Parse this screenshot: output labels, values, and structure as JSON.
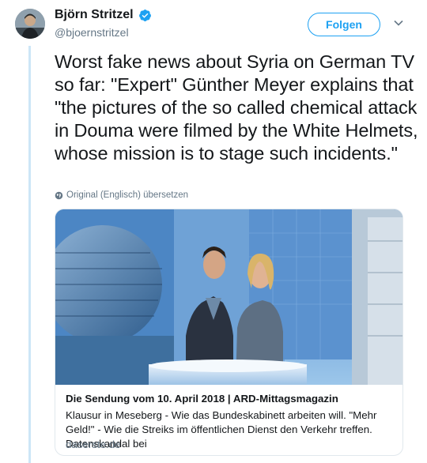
{
  "author": {
    "name": "Björn Stritzel",
    "handle": "@bjoernstritzel",
    "verified": true
  },
  "follow_button": {
    "label": "Folgen"
  },
  "tweet": {
    "text": "Worst fake news about Syria on German TV so far: \"Expert\" Günther Meyer explains that \"the pictures of the so called chemical attack in Douma were filmed by the White Helmets, whose mission is to stage such incidents.\""
  },
  "translate": {
    "label": "Original (Englisch) übersetzen"
  },
  "card": {
    "title": "Die Sendung vom 10. April 2018 | ARD-Mittagsmagazin",
    "description": "Klausur in Meseberg - Wie das Bundeskabinett arbeiten will. \"Mehr Geld!\" - Wie die Streiks im öffentlichen Dienst den Verkehr treffen. Datenskandal bei",
    "domain": "daserste.de"
  },
  "colors": {
    "accent": "#1da1f2",
    "secondary_text": "#657786",
    "thread_line": "#cde6f7"
  },
  "icons": [
    "globe-icon",
    "verified-badge-icon",
    "chevron-down-icon"
  ]
}
